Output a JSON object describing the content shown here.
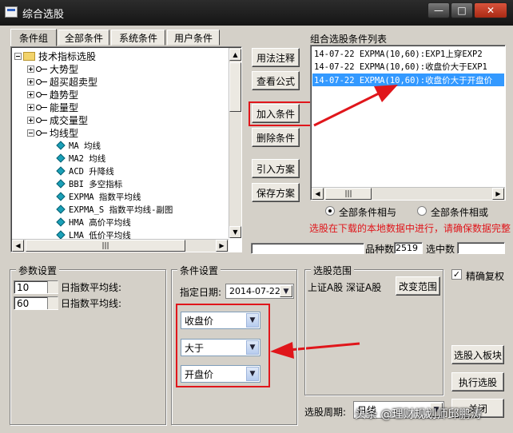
{
  "window": {
    "title": "综合选股",
    "controls": [
      "—",
      "□",
      "✕"
    ]
  },
  "tabs": [
    "条件组",
    "全部条件",
    "系统条件",
    "用户条件"
  ],
  "tree": {
    "root": "技术指标选股",
    "categories": [
      "大势型",
      "超买超卖型",
      "趋势型",
      "能量型",
      "成交量型",
      "均线型"
    ],
    "indicators": [
      "MA 均线",
      "MA2 均线",
      "ACD 升降线",
      "BBI 多空指标",
      "EXPMA 指数平均线",
      "EXPMA_S 指数平均线-副图",
      "HMA 高价平均线",
      "LMA 低价平均线"
    ]
  },
  "middle_buttons": [
    "用法注释",
    "查看公式",
    "加入条件",
    "删除条件",
    "引入方案",
    "保存方案"
  ],
  "condition_list": {
    "label": "组合选股条件列表",
    "items": [
      "14-07-22 EXPMA(10,60):EXP1上穿EXP2",
      "14-07-22 EXPMA(10,60):收盘价大于EXP1",
      "14-07-22 EXPMA(10,60):收盘价大于开盘价"
    ],
    "selected_index": 2
  },
  "logic": {
    "and_label": "全部条件相与",
    "or_label": "全部条件相或",
    "selected": "and"
  },
  "warning": "选股在下载的本地数据中进行，请确保数据完整",
  "stats": {
    "count_label": "品种数",
    "count_value": "2519",
    "selected_label": "选中数",
    "selected_value": ""
  },
  "params": {
    "title": "参数设置",
    "rows": [
      {
        "value": "10",
        "label": "日指数平均线:"
      },
      {
        "value": "60",
        "label": "日指数平均线:"
      }
    ]
  },
  "condition_settings": {
    "title": "条件设置",
    "date_label": "指定日期:",
    "date_value": "2014-07-22",
    "selects": [
      "收盘价",
      "大于",
      "开盘价"
    ]
  },
  "range": {
    "title": "选股范围",
    "markets": "上证A股 深证A股",
    "change_button": "改变范围",
    "period_label": "选股周期:",
    "period_value": "日线"
  },
  "right_panel": {
    "precise_label": "精确复权",
    "precise_checked": true,
    "to_sector_button": "选股入板块",
    "execute_button": "执行选股",
    "close_button": "关闭"
  },
  "watermark": "头条 @理财规划师邱鹏涛",
  "colors": {
    "selection": "#3399ff",
    "warning": "#e0161b",
    "titlebar": "#1e1e1e",
    "dialog": "#d4d0c8"
  }
}
